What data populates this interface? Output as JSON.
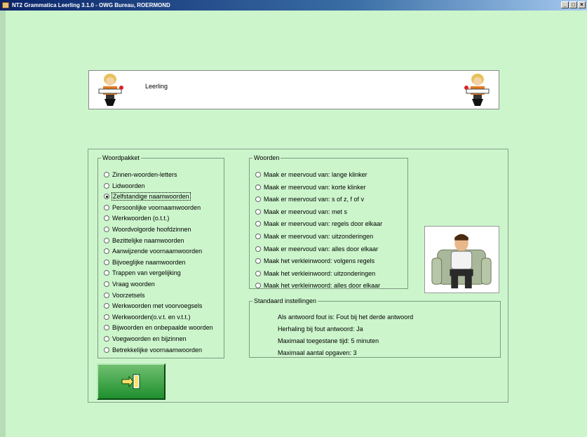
{
  "window": {
    "title": "NT2 Grammatica Leerling  3.1.0 - OWG Bureau, ROERMOND"
  },
  "header": {
    "label": "Leerling"
  },
  "woordpakket": {
    "legend": "Woordpakket",
    "items": [
      "Zinnen-woorden-letters",
      "Lidwoorden",
      "Zelfstandige naamwoorden",
      "Persoonlijke voornaamwoorden",
      "Werkwoorden (o.t.t.)",
      "Woordvolgorde hoofdzinnen",
      "Bezittelijke naamwoorden",
      "Aanwijzende voornaamwoorden",
      "Bijvoeglijke naamwoorden",
      "Trappen van vergelijking",
      "Vraag woorden",
      "Voorzetsels",
      "Werkwoorden met voorvoegsels",
      "Werkwoorden(o.v.t. en v.t.t.)",
      "Bijwoorden en onbepaalde woorden",
      "Voegwoorden en bijzinnen",
      "Betrekkelijke voornaamwoorden"
    ],
    "selected_index": 2
  },
  "woorden": {
    "legend": "Woorden",
    "items": [
      "Maak er meervoud van: lange klinker",
      "Maak er meervoud van: korte klinker",
      "Maak er meervoud van: s of z, f of v",
      "Maak er meervoud van: met s",
      "Maak er meervoud van: regels door elkaar",
      "Maak er meervoud van: uitzonderingen",
      "Maak er meervoud van: alles door elkaar",
      "Maak het verkleinwoord: volgens regels",
      "Maak het verkleinwoord: uitzonderingen",
      "Maak het verkleinwoord: alles door elkaar"
    ]
  },
  "instellingen": {
    "legend": "Standaard instellingen",
    "rows": [
      "Als antwoord fout is: Fout bij het derde antwoord",
      "Herhaling bij fout antwoord: Ja",
      "Maximaal toegestane tijd: 5 minuten",
      "Maximaal aantal opgaven: 3"
    ]
  },
  "icons": {
    "exit": "exit-door-icon",
    "teacher": "teacher-at-desk-icon",
    "student": "student-in-armchair-icon"
  }
}
